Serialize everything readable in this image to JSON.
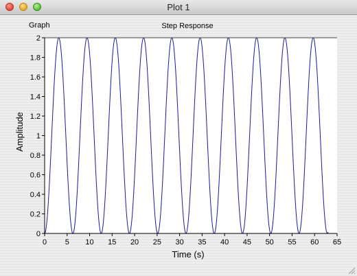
{
  "window": {
    "title": "Plot 1"
  },
  "panel": {
    "label": "Graph"
  },
  "chart_data": {
    "type": "line",
    "title": "Step Response",
    "xlabel": "Time (s)",
    "ylabel": "Amplitude",
    "xlim": [
      0,
      65
    ],
    "ylim": [
      0,
      2
    ],
    "xticks": [
      0,
      5,
      10,
      15,
      20,
      25,
      30,
      35,
      40,
      45,
      50,
      55,
      60,
      65
    ],
    "yticks": [
      0,
      0.2,
      0.4,
      0.6,
      0.8,
      1,
      1.2,
      1.4,
      1.6,
      1.8,
      2
    ],
    "x_range_data": [
      0,
      63
    ],
    "series": [
      {
        "omega": 1,
        "formula": "1 - cos(t)",
        "color": "#1a1aa0"
      }
    ]
  }
}
